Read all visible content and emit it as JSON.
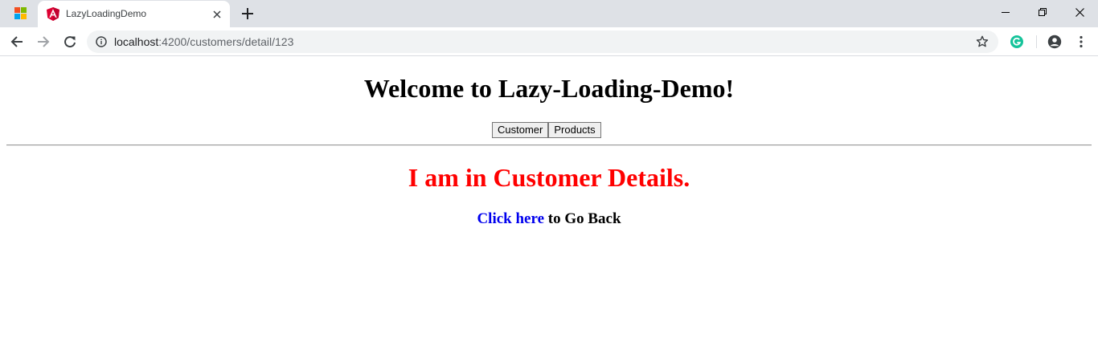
{
  "browser": {
    "tab": {
      "title": "LazyLoadingDemo",
      "favicon": "angular-icon"
    },
    "address_bar": {
      "url_host": "localhost",
      "url_path": ":4200/customers/detail/123"
    },
    "icons": {
      "back": "back-arrow-icon",
      "forward": "forward-arrow-icon",
      "reload": "reload-icon",
      "site_info": "info-icon",
      "bookmark": "star-icon",
      "extension": "grammarly-icon",
      "profile": "profile-icon",
      "menu": "kebab-menu-icon"
    },
    "colors": {
      "tabstrip": "#dee1e6",
      "omnibox": "#f1f3f4",
      "angular_red": "#dd0031",
      "grammarly_green": "#15c39a"
    }
  },
  "page": {
    "title": "Welcome to Lazy-Loading-Demo!",
    "nav": {
      "customer_label": "Customer",
      "products_label": "Products"
    },
    "details_heading": "I am in Customer Details.",
    "back": {
      "link_text": "Click here",
      "suffix_text": " to Go Back"
    },
    "colors": {
      "heading": "#000000",
      "details_heading": "#ff0000",
      "link": "#0000ee"
    }
  }
}
